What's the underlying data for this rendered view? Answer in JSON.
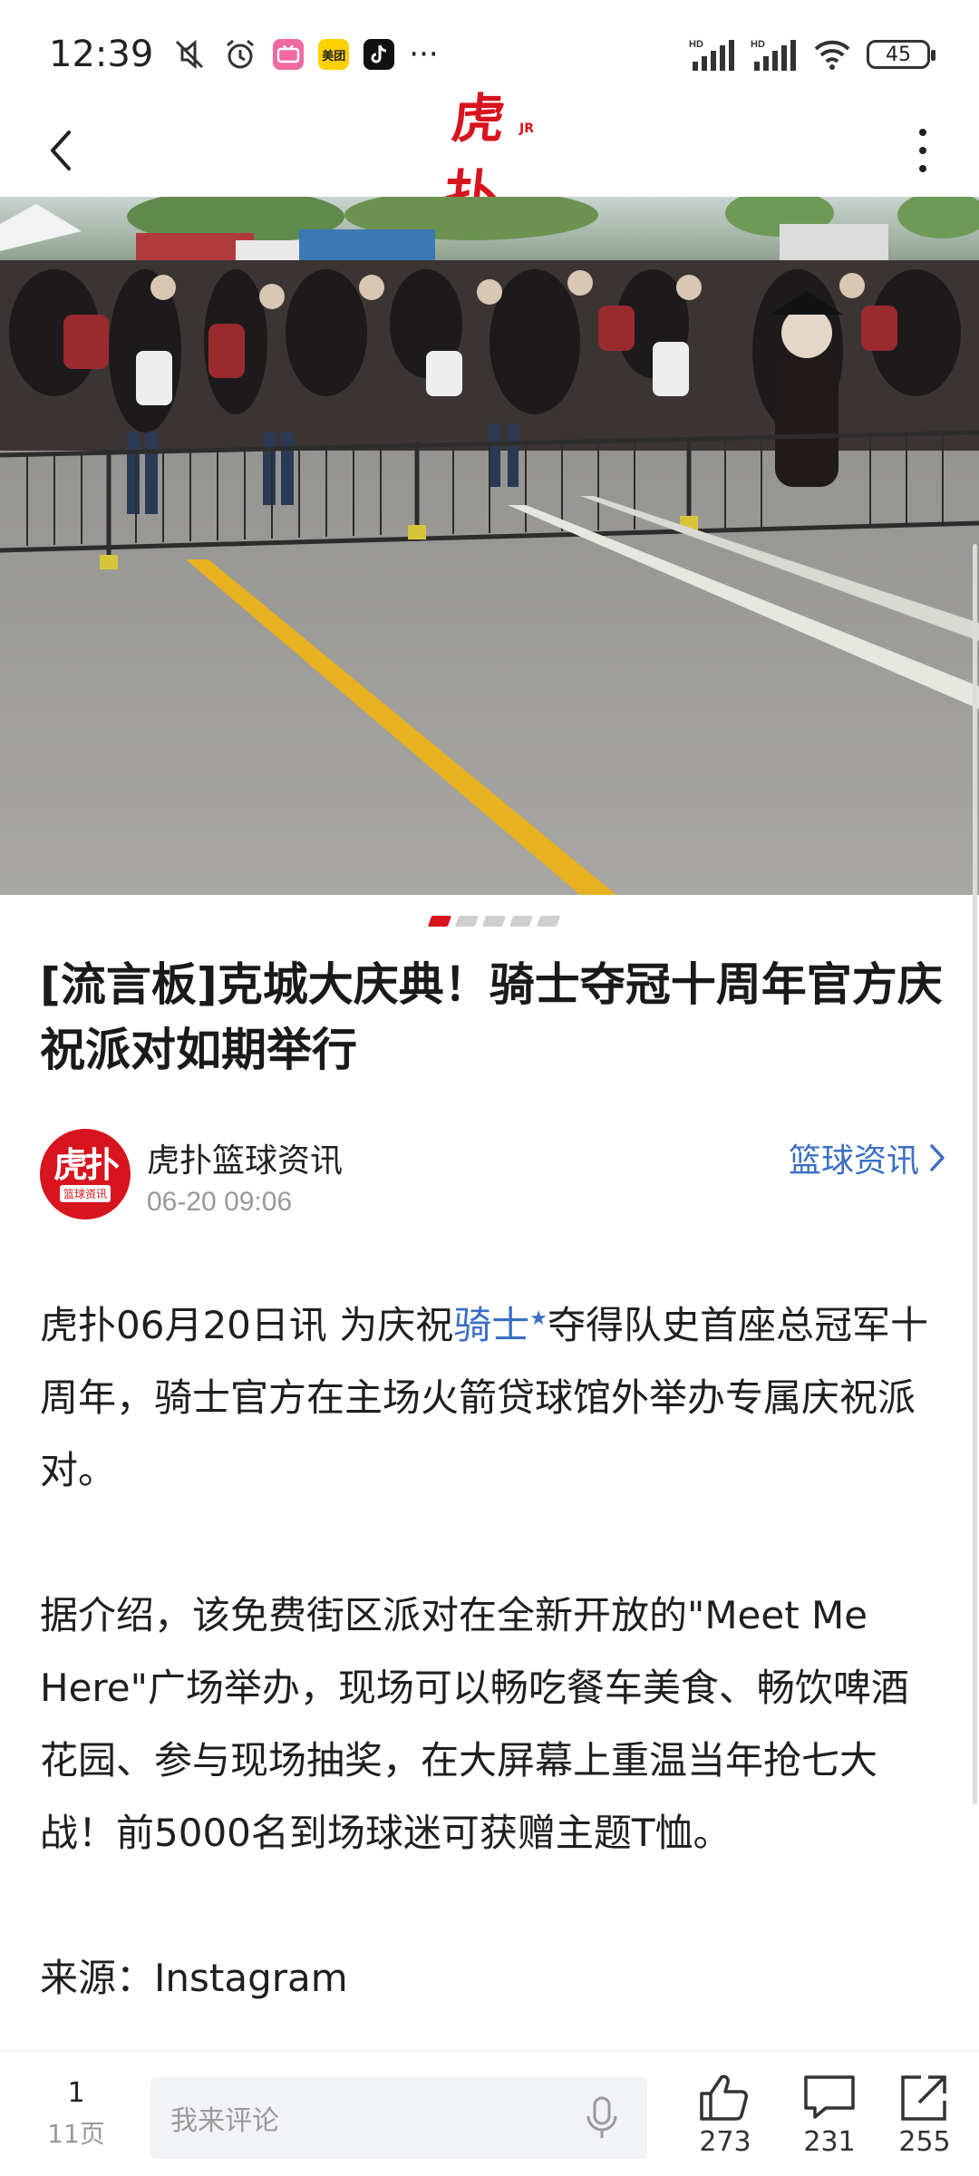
{
  "status_bar": {
    "time": "12:39",
    "battery": "45",
    "notification_icons": [
      "mute-icon",
      "alarm-icon",
      "bilibili-icon",
      "meituan-icon",
      "tiktok-icon",
      "more-dots-icon"
    ],
    "meituan_label": "美团",
    "more": "···",
    "signal_labels": [
      "HD",
      "HD"
    ]
  },
  "nav": {
    "logo_text": "虎扑",
    "logo_sup": "JR"
  },
  "carousel": {
    "total": 5,
    "active_index": 0
  },
  "article": {
    "title": "[流言板]克城大庆典！骑士夺冠十周年官方庆祝派对如期举行",
    "author": {
      "name": "虎扑篮球资讯",
      "avatar_main": "虎扑",
      "avatar_sub": "篮球资讯",
      "time": "06-20 09:06"
    },
    "category": "篮球资讯",
    "para1": {
      "before": "虎扑06月20日讯 为庆祝",
      "link": "骑士",
      "after": "夺得队史首座总冠军十周年，骑士官方在主场火箭贷球馆外举办专属庆祝派对。"
    },
    "para2": "据介绍，该免费街区派对在全新开放的\"Meet Me Here\"广场举办，现场可以畅吃餐车美食、畅饮啤酒花园、参与现场抽奖，在大屏幕上重温当年抢七大战！前5000名到场球迷可获赠主题T恤。",
    "source": "来源：Instagram"
  },
  "bottom_bar": {
    "page_num": "1",
    "page_total": "11页",
    "comment_placeholder": "我来评论",
    "likes": "273",
    "comments": "231",
    "shares": "255"
  },
  "colors": {
    "brand_red": "#d8141e",
    "link_blue": "#3a6fc4"
  }
}
